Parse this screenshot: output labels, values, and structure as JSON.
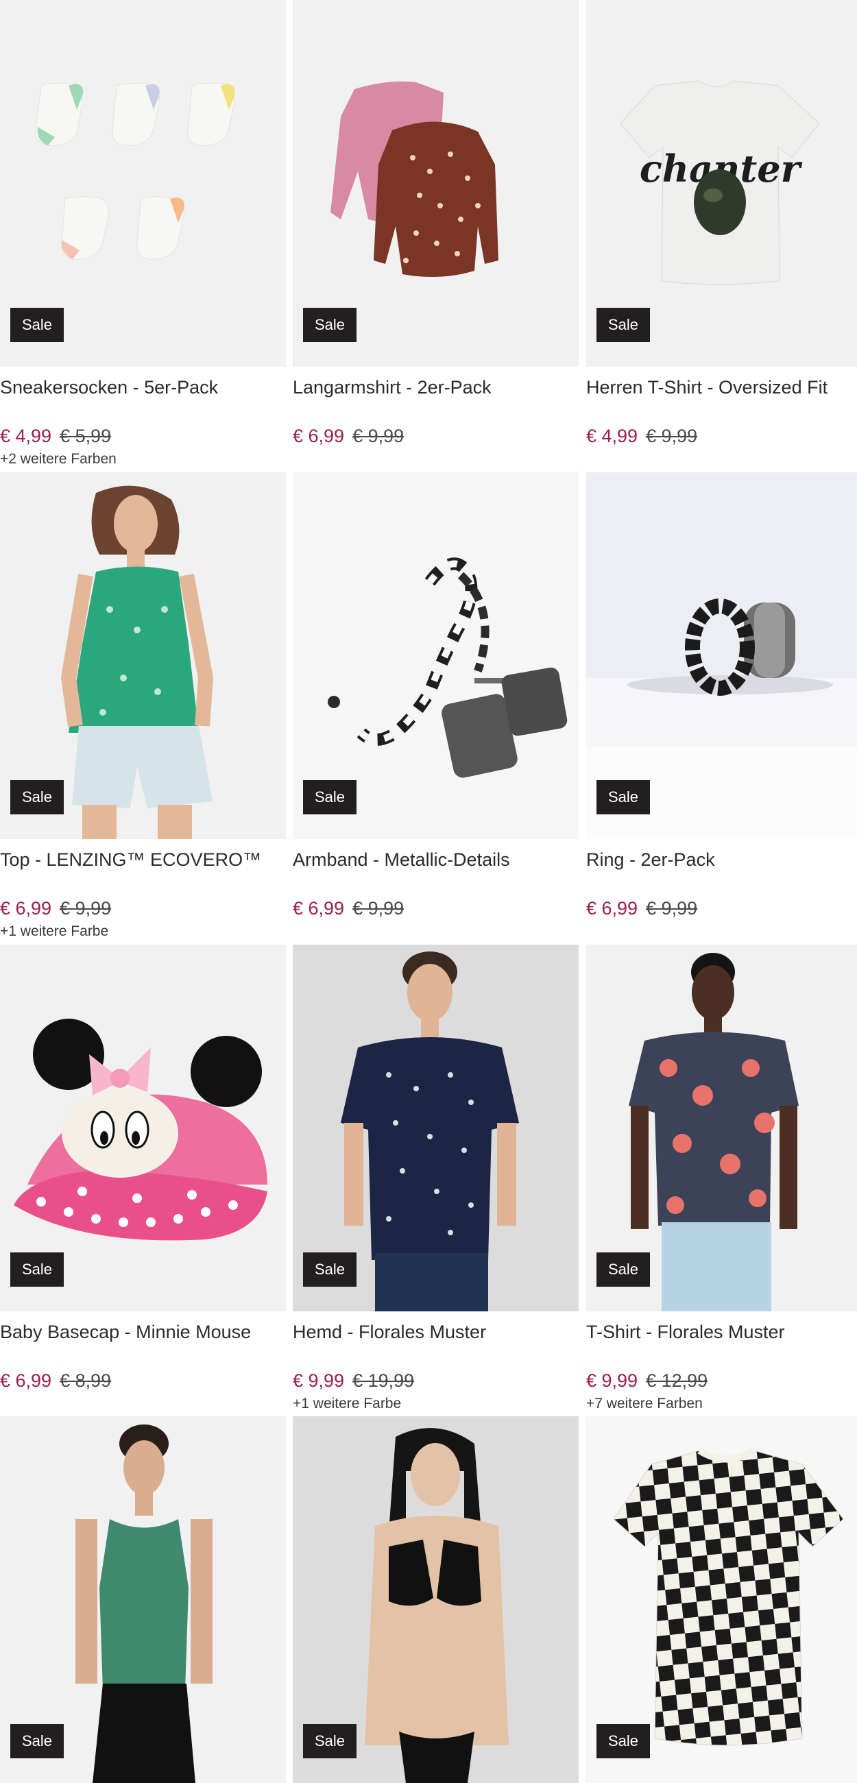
{
  "products": [
    {
      "title": "Sneakersocken - 5er-Pack",
      "price": "€ 4,99",
      "old_price": "€ 5,99",
      "badge": "Sale",
      "colors": "+2 weitere Farben",
      "image": "socks-5-pack"
    },
    {
      "title": "Langarmshirt - 2er-Pack",
      "price": "€ 6,99",
      "old_price": "€ 9,99",
      "badge": "Sale",
      "colors": "",
      "image": "longsleeve-2-pack"
    },
    {
      "title": "Herren T-Shirt - Oversized Fit",
      "price": "€ 4,99",
      "old_price": "€ 9,99",
      "badge": "Sale",
      "colors": "",
      "image": "white-tshirt-print",
      "print_text": "chanter"
    },
    {
      "title": "Top - LENZING™ ECOVERO™",
      "price": "€ 6,99",
      "old_price": "€ 9,99",
      "badge": "Sale",
      "colors": "+1 weitere Farbe",
      "image": "green-top-model"
    },
    {
      "title": "Armband - Metallic-Details",
      "price": "€ 6,99",
      "old_price": "€ 9,99",
      "badge": "Sale",
      "colors": "",
      "image": "phone-chain-strap"
    },
    {
      "title": "Ring - 2er-Pack",
      "price": "€ 6,99",
      "old_price": "€ 9,99",
      "badge": "Sale",
      "colors": "",
      "image": "rings-2-pack"
    },
    {
      "title": "Baby Basecap - Minnie Mouse",
      "price": "€ 6,99",
      "old_price": "€ 8,99",
      "badge": "Sale",
      "colors": "",
      "image": "minnie-cap"
    },
    {
      "title": "Hemd - Florales Muster",
      "price": "€ 9,99",
      "old_price": "€ 19,99",
      "badge": "Sale",
      "colors": "+1 weitere Farbe",
      "image": "floral-shirt-model"
    },
    {
      "title": "T-Shirt - Florales Muster",
      "price": "€ 9,99",
      "old_price": "€ 12,99",
      "badge": "Sale",
      "colors": "+7 weitere Farben",
      "image": "floral-tshirt-model"
    },
    {
      "title": "",
      "price": "",
      "old_price": "",
      "badge": "Sale",
      "colors": "",
      "image": "sport-top-model"
    },
    {
      "title": "",
      "price": "",
      "old_price": "",
      "badge": "Sale",
      "colors": "",
      "image": "bikini-model"
    },
    {
      "title": "",
      "price": "",
      "old_price": "",
      "badge": "Sale",
      "colors": "",
      "image": "checkered-tshirt"
    }
  ],
  "colors": {
    "sale_badge": "#231f20",
    "price": "#9b1f4a",
    "tile_bg": "#f1f1f1"
  }
}
